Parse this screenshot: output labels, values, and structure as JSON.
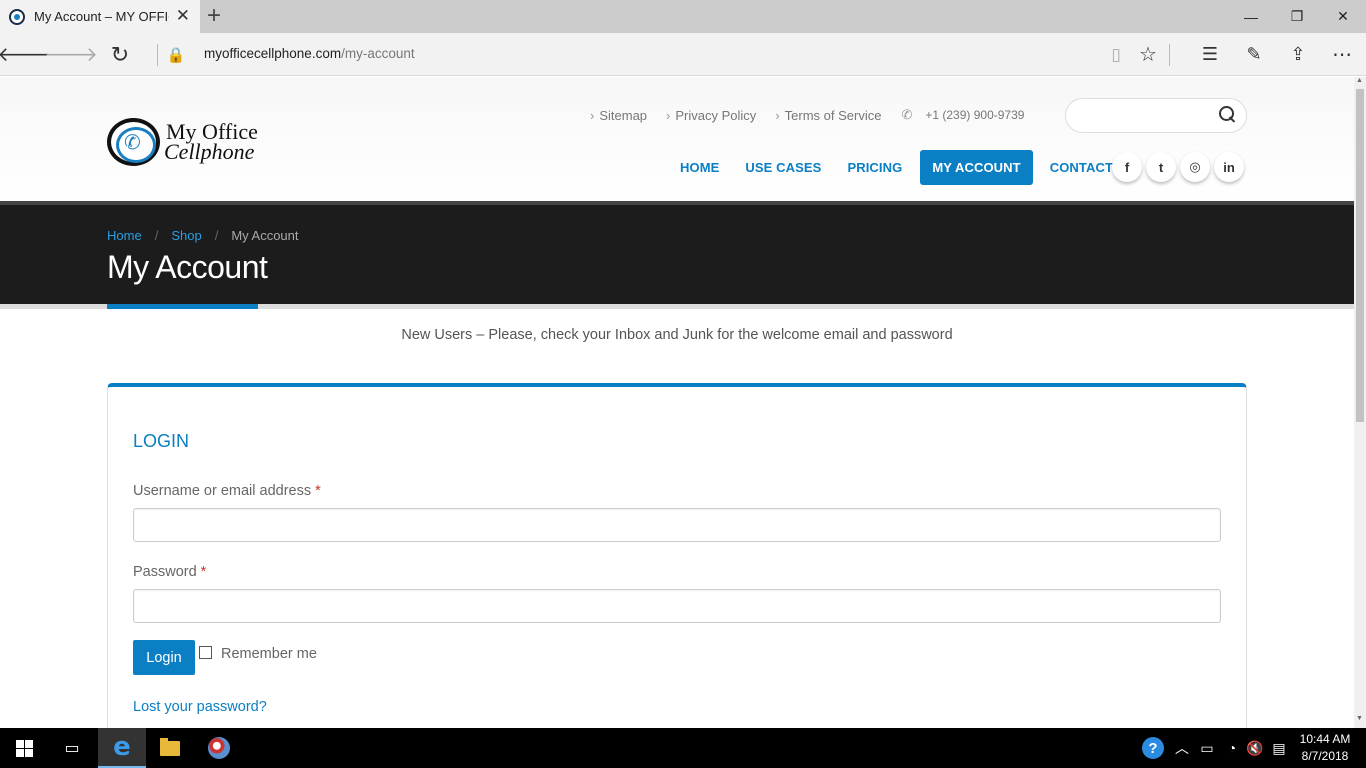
{
  "browser": {
    "tab_title": "My Account – MY OFFIC",
    "tab_close": "✕",
    "new_tab": "+",
    "url_domain": "myofficecellphone.com",
    "url_path": "/my-account",
    "window_controls": {
      "minimize": "—",
      "restore": "❐",
      "close": "✕"
    },
    "icons": [
      "back-icon",
      "forward-icon",
      "refresh-icon",
      "lock-icon",
      "reading-view-icon",
      "favorite-star-icon",
      "hub-icon",
      "web-note-icon",
      "share-icon",
      "more-icon"
    ]
  },
  "site": {
    "logo_line1": "My Office",
    "logo_line2": "Cellphone",
    "top_links": [
      "Sitemap",
      "Privacy Policy",
      "Terms of Service"
    ],
    "phone": "+1 (239) 900-9739",
    "search_placeholder": "",
    "nav": [
      {
        "label": "HOME",
        "active": false
      },
      {
        "label": "USE CASES",
        "active": false
      },
      {
        "label": "PRICING",
        "active": false
      },
      {
        "label": "MY ACCOUNT",
        "active": true
      },
      {
        "label": "CONTACT US",
        "active": false
      }
    ],
    "socials": [
      "f",
      "t",
      "◎",
      "in"
    ],
    "social_icons": [
      "facebook-icon",
      "twitter-icon",
      "instagram-icon",
      "linkedin-icon"
    ],
    "accent_color": "#0a7fc3"
  },
  "banner": {
    "breadcrumb": [
      "Home",
      "Shop",
      "My Account"
    ],
    "breadcrumb_sep": "/",
    "title": "My Account"
  },
  "notice": "New Users – Please, check your Inbox and Junk for the welcome email and password",
  "login": {
    "title": "LOGIN",
    "username_label": "Username or email address",
    "password_label": "Password",
    "required_mark": "*",
    "username_value": "",
    "password_value": "",
    "button": "Login",
    "remember_label": "Remember me",
    "remember_checked": false,
    "lost_password": "Lost your password?"
  },
  "taskbar": {
    "time": "10:44 AM",
    "date": "8/7/2018",
    "help": "?"
  }
}
